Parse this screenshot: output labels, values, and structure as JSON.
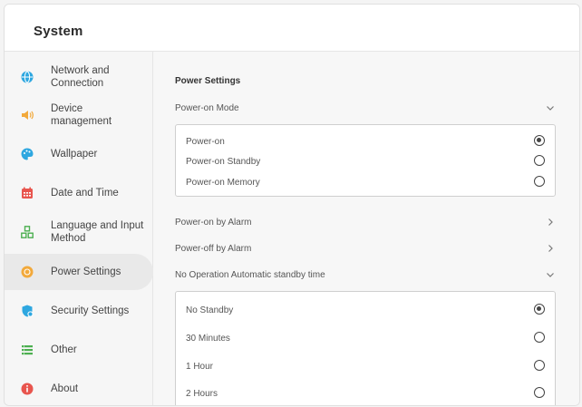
{
  "header": {
    "title": "System"
  },
  "sidebar": {
    "items": [
      {
        "label": "Network and\nConnection",
        "icon": "globe-icon",
        "color": "#2ea7e0"
      },
      {
        "label": "Device\nmanagement",
        "icon": "speaker-icon",
        "color": "#f2a93b"
      },
      {
        "label": "Wallpaper",
        "icon": "palette-icon",
        "color": "#2ea7e0"
      },
      {
        "label": "Date and Time",
        "icon": "calendar-icon",
        "color": "#e8554e"
      },
      {
        "label": "Language and Input\nMethod",
        "icon": "language-icon",
        "color": "#4caf50"
      },
      {
        "label": "Power Settings",
        "icon": "power-icon",
        "color": "#f2a93b",
        "active": true
      },
      {
        "label": "Security Settings",
        "icon": "shield-icon",
        "color": "#2ea7e0"
      },
      {
        "label": "Other",
        "icon": "list-icon",
        "color": "#4caf50"
      },
      {
        "label": "About",
        "icon": "info-icon",
        "color": "#e8554e"
      }
    ]
  },
  "main": {
    "section_title": "Power Settings",
    "power_on_mode": {
      "label": "Power-on Mode",
      "options": [
        {
          "label": "Power-on",
          "selected": true
        },
        {
          "label": "Power-on Standby",
          "selected": false
        },
        {
          "label": "Power-on Memory",
          "selected": false
        }
      ]
    },
    "power_on_alarm": "Power-on by Alarm",
    "power_off_alarm": "Power-off by Alarm",
    "standby": {
      "label": "No Operation Automatic standby time",
      "options": [
        {
          "label": "No Standby",
          "selected": true
        },
        {
          "label": "30 Minutes",
          "selected": false
        },
        {
          "label": "1 Hour",
          "selected": false
        },
        {
          "label": "2 Hours",
          "selected": false
        }
      ]
    }
  }
}
